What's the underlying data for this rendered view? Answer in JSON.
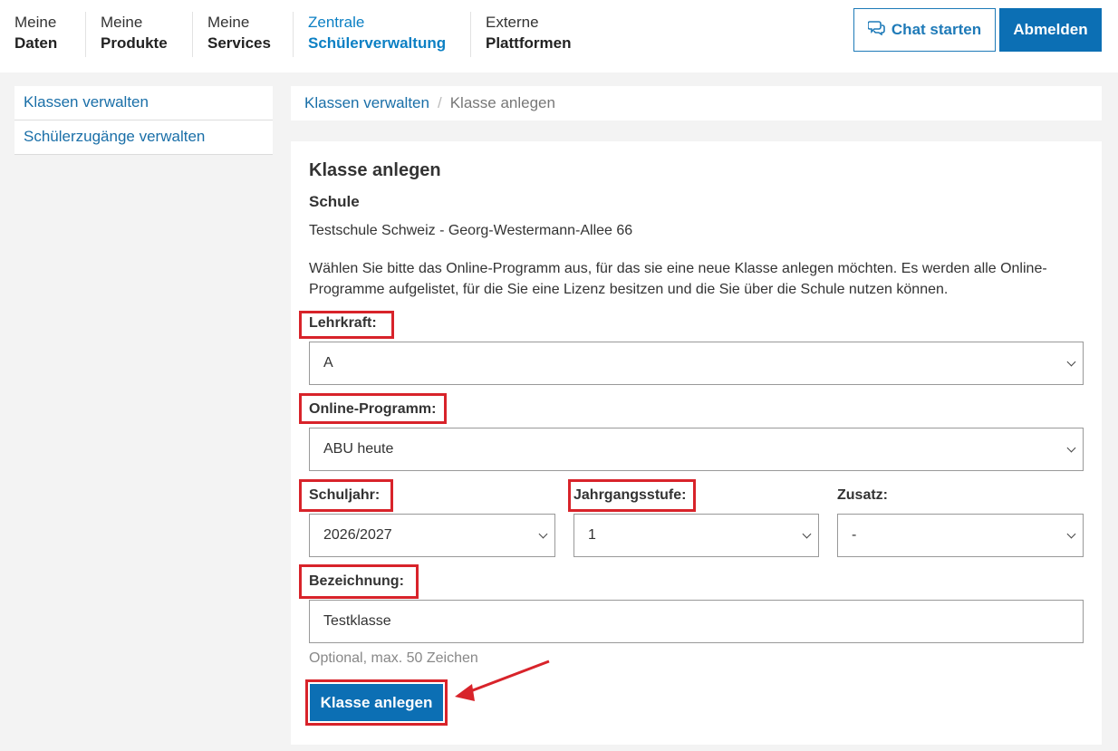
{
  "nav": [
    {
      "line1": "Meine",
      "line2": "Daten"
    },
    {
      "line1": "Meine",
      "line2": "Produkte"
    },
    {
      "line1": "Meine",
      "line2": "Services"
    },
    {
      "line1": "Zentrale",
      "line2": "Schülerverwaltung"
    },
    {
      "line1": "Externe",
      "line2": "Plattformen"
    }
  ],
  "header": {
    "chat_label": "Chat starten",
    "logout_label": "Abmelden"
  },
  "sidebar": {
    "items": [
      {
        "label": "Klassen verwalten"
      },
      {
        "label": "Schülerzugänge verwalten"
      }
    ]
  },
  "breadcrumb": {
    "parent": "Klassen verwalten",
    "separator": "/",
    "current": "Klasse anlegen"
  },
  "form": {
    "title": "Klasse anlegen",
    "school_heading": "Schule",
    "school_name": "Testschule Schweiz - Georg-Westermann-Allee 66",
    "intro": "Wählen Sie bitte das Online-Programm aus, für das sie eine neue Klasse anlegen möchten. Es werden alle Online-Programme aufgelistet, für die Sie eine Lizenz besitzen und die Sie über die Schule nutzen können.",
    "teacher_label": "Lehrkraft:",
    "teacher_value": "A",
    "program_label": "Online-Programm:",
    "program_value": "ABU heute",
    "year_label": "Schuljahr:",
    "year_value": "2026/2027",
    "grade_label": "Jahrgangsstufe:",
    "grade_value": "1",
    "suffix_label": "Zusatz:",
    "suffix_value": "-",
    "name_label": "Bezeichnung:",
    "name_value": "Testklasse",
    "name_hint": "Optional, max. 50 Zeichen",
    "submit_label": "Klasse anlegen"
  },
  "colors": {
    "accent": "#0c6fb4",
    "link": "#1a6fa8",
    "highlight": "#d8232a"
  }
}
